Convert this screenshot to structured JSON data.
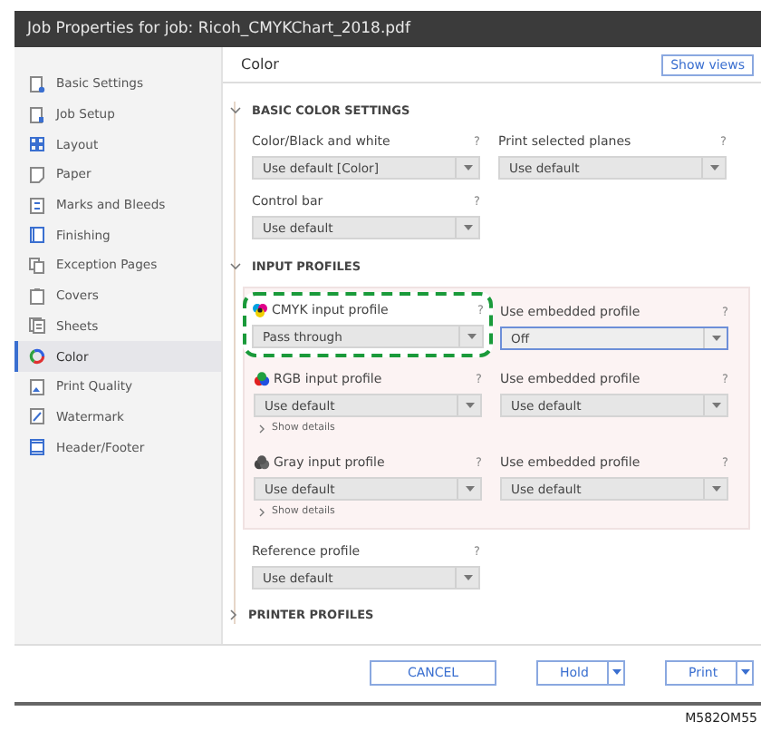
{
  "window": {
    "title": "Job Properties for job: Ricoh_CMYKChart_2018.pdf"
  },
  "sidebar": {
    "items": [
      {
        "label": "Basic Settings",
        "selected": false
      },
      {
        "label": "Job Setup",
        "selected": false
      },
      {
        "label": "Layout",
        "selected": false
      },
      {
        "label": "Paper",
        "selected": false
      },
      {
        "label": "Marks and Bleeds",
        "selected": false
      },
      {
        "label": "Finishing",
        "selected": false
      },
      {
        "label": "Exception Pages",
        "selected": false
      },
      {
        "label": "Covers",
        "selected": false
      },
      {
        "label": "Sheets",
        "selected": false
      },
      {
        "label": "Color",
        "selected": true
      },
      {
        "label": "Print Quality",
        "selected": false
      },
      {
        "label": "Watermark",
        "selected": false
      },
      {
        "label": "Header/Footer",
        "selected": false
      }
    ]
  },
  "content": {
    "title": "Color",
    "show_views": "Show views",
    "basic": {
      "title": "BASIC COLOR SETTINGS",
      "expanded": true,
      "fields": [
        {
          "label": "Color/Black and white",
          "help": "?",
          "value": "Use default [Color]"
        },
        {
          "label": "Print selected planes",
          "help": "?",
          "value": "Use default"
        },
        {
          "label": "Control bar",
          "help": "?",
          "value": "Use default"
        }
      ]
    },
    "input_profiles": {
      "title": "INPUT PROFILES",
      "expanded": true,
      "profiles": [
        {
          "label": "CMYK input profile",
          "help": "?",
          "value": "Pass through",
          "highlighted": true,
          "embedded": {
            "label": "Use embedded profile",
            "help": "?",
            "value": "Off",
            "focused": true
          }
        },
        {
          "label": "RGB input profile",
          "help": "?",
          "value": "Use default",
          "highlighted": false,
          "show_details": "Show details",
          "embedded": {
            "label": "Use embedded profile",
            "help": "?",
            "value": "Use default",
            "focused": false
          }
        },
        {
          "label": "Gray input profile",
          "help": "?",
          "value": "Use default",
          "highlighted": false,
          "show_details": "Show details",
          "embedded": {
            "label": "Use embedded profile",
            "help": "?",
            "value": "Use default",
            "focused": false
          }
        }
      ]
    },
    "reference": {
      "label": "Reference profile",
      "help": "?",
      "value": "Use default"
    },
    "printer_profiles": {
      "title": "PRINTER PROFILES",
      "expanded": false
    }
  },
  "footer": {
    "buttons": [
      {
        "label": "CANCEL",
        "kind": "plain"
      },
      {
        "label": "Hold",
        "kind": "split"
      },
      {
        "label": "Print",
        "kind": "split"
      }
    ]
  },
  "caption": "M582OM55"
}
